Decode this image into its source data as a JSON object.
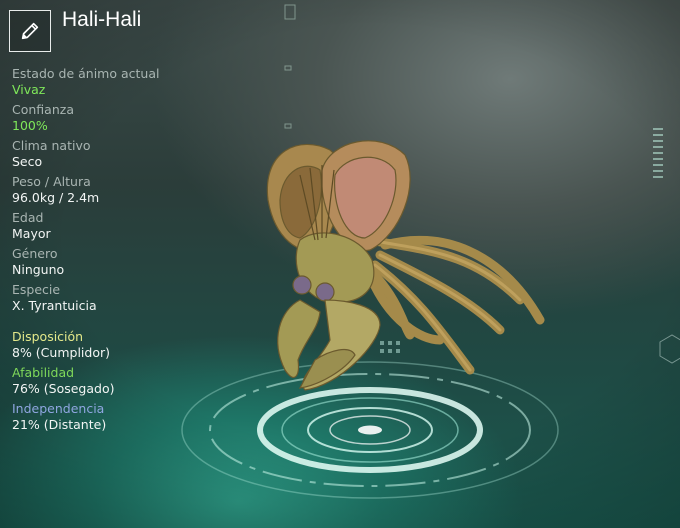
{
  "creature": {
    "name": "Hali-Hali"
  },
  "stats": [
    {
      "label": "Estado de ánimo actual",
      "value": "Vivaz",
      "highlight": true
    },
    {
      "label": "Confianza",
      "value": "100%",
      "highlight": true
    },
    {
      "label": "Clima nativo",
      "value": "Seco"
    },
    {
      "label": "Peso / Altura",
      "value": "96.0kg / 2.4m"
    },
    {
      "label": "Edad",
      "value": "Mayor"
    },
    {
      "label": "Género",
      "value": "Ninguno"
    },
    {
      "label": "Especie",
      "value": "X. Tyrantuicia"
    }
  ],
  "traits": [
    {
      "label": "Disposición",
      "value": "8% (Cumplidor)",
      "color": "#e3e88a"
    },
    {
      "label": "Afabilidad",
      "value": "76% (Sosegado)",
      "color": "#7fd85a"
    },
    {
      "label": "Independencia",
      "value": "21% (Distante)",
      "color": "#8fa6e0"
    }
  ],
  "icons": {
    "edit": "pencil-icon"
  }
}
